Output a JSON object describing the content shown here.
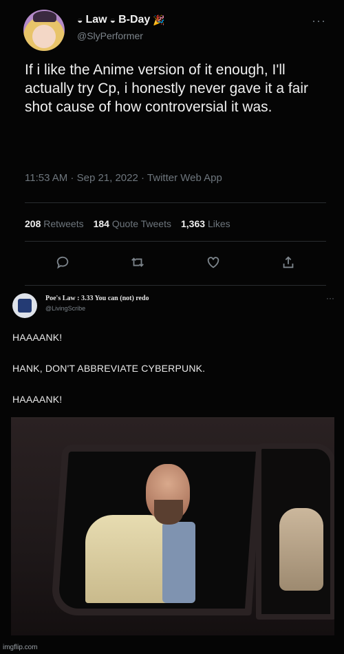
{
  "tweet": {
    "display_name": "Law",
    "display_suffix": "B-Day",
    "emoji_left": "◒",
    "emoji_mid": "◒",
    "emoji_party": "🎉",
    "handle": "@SlyPerformer",
    "more": "···",
    "text": "If i like the Anime version of it enough, I'll actually try Cp, i honestly never gave it a fair shot cause of how controversial it was.",
    "meta": "11:53 AM · Sep 21, 2022 · Twitter Web App",
    "stats": [
      {
        "value": "208",
        "label": "Retweets"
      },
      {
        "value": "184",
        "label": "Quote Tweets"
      },
      {
        "value": "1,363",
        "label": "Likes"
      }
    ],
    "actions": [
      "reply-icon",
      "retweet-icon",
      "like-icon",
      "share-icon"
    ]
  },
  "reply": {
    "name": "Poe's Law : 3.33 You can (not) redo",
    "handle": "@LivingScribe",
    "more": "···",
    "lines": [
      "HAAAANK!",
      "HANK, DON'T ABBREVIATE CYBERPUNK.",
      "HAAAANK!"
    ]
  },
  "credit": "imgflip.com",
  "colors": {
    "background": "#050505",
    "muted": "#6e767d",
    "text": "#f0f0f0"
  }
}
